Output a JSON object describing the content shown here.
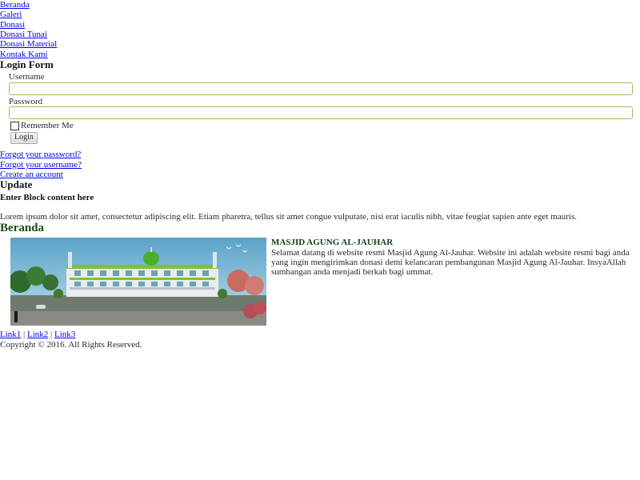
{
  "nav": {
    "items": [
      {
        "label": "Beranda"
      },
      {
        "label": "Galeri"
      },
      {
        "label": "Donasi"
      },
      {
        "label": "Donasi Tunai"
      },
      {
        "label": "Donasi Material"
      },
      {
        "label": "Kontak Kami"
      }
    ]
  },
  "login": {
    "title": "Login Form",
    "username_label": "Username",
    "username_value": "",
    "password_label": "Password",
    "password_value": "",
    "remember_label": "Remember Me",
    "remember_checked": false,
    "submit_label": "Login",
    "links": [
      {
        "label": "Forgot your password?"
      },
      {
        "label": "Forgot your username?"
      },
      {
        "label": "Create an account"
      }
    ]
  },
  "update_block": {
    "title": "Update",
    "subtitle": "Enter Block content here",
    "body": "Lorem ipsum dolor sit amet, consectetur adipiscing elit. Etiam pharetra, tellus sit amet congue vulputate, nisi erat iaculis nibh, vitae feugiat sapien ante eget mauris."
  },
  "main": {
    "heading": "Beranda",
    "article_title": "MASJID AGUNG AL-JAUHAR",
    "article_body": "Selamat datang di website resmi Masjid Agung Al-Jauhar. Website ini adalah website resmi bagi anda yang ingin mengirimkan donasi demi kelancaran pembangunan Masjid Agung Al-Jauhar. InsyaAllah sumbangan anda menjadi berkah bagi ummat."
  },
  "footer": {
    "links": [
      {
        "label": "Link1"
      },
      {
        "label": "Link2"
      },
      {
        "label": "Link3"
      }
    ],
    "separator": "|",
    "copyright": "Copyright © 2016. All Rights Reserved."
  },
  "colors": {
    "link": "#0000ee",
    "input_border": "#9fbf57",
    "heading": "#134d13"
  }
}
